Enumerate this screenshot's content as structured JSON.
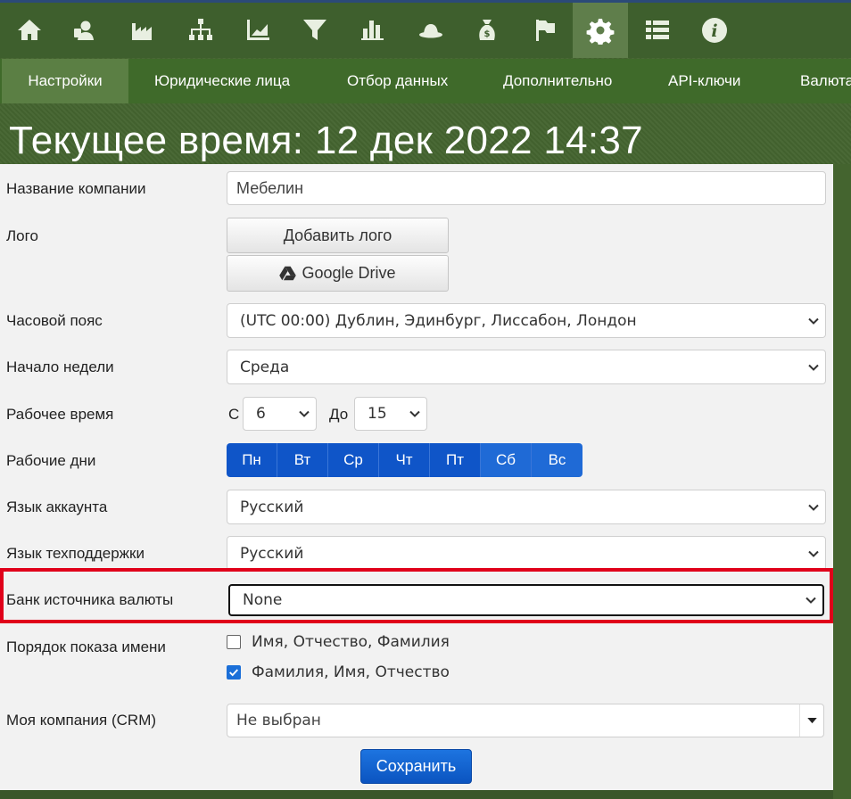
{
  "nav_icons": [
    {
      "name": "home-icon"
    },
    {
      "name": "contacts-icon"
    },
    {
      "name": "factory-icon"
    },
    {
      "name": "org-chart-icon"
    },
    {
      "name": "area-chart-icon"
    },
    {
      "name": "filter-icon"
    },
    {
      "name": "bar-chart-icon"
    },
    {
      "name": "hat-icon"
    },
    {
      "name": "money-bag-icon"
    },
    {
      "name": "flag-icon"
    },
    {
      "name": "gear-icon",
      "active": true
    },
    {
      "name": "list-icon"
    },
    {
      "name": "info-icon"
    }
  ],
  "tabs": [
    {
      "label": "Настройки",
      "active": true
    },
    {
      "label": "Юридические лица"
    },
    {
      "label": "Отбор данных"
    },
    {
      "label": "Дополнительно"
    },
    {
      "label": "API-ключи"
    },
    {
      "label": "Валюта"
    }
  ],
  "page_title": "Текущее время: 12 дек 2022 14:37",
  "form": {
    "company_name_label": "Название компании",
    "company_name_value": "Мебелин",
    "logo_label": "Лого",
    "add_logo_button": "Добавить лого",
    "google_drive_button": "Google Drive",
    "timezone_label": "Часовой пояс",
    "timezone_value": "(UTC 00:00) Дублин, Эдинбург, Лиссабон, Лондон",
    "week_start_label": "Начало недели",
    "week_start_value": "Среда",
    "work_time_label": "Рабочее время",
    "work_time_from_label": "С",
    "work_time_from_value": "6",
    "work_time_to_label": "До",
    "work_time_to_value": "15",
    "work_days_label": "Рабочие дни",
    "work_days": [
      "Пн",
      "Вт",
      "Ср",
      "Чт",
      "Пт",
      "Сб",
      "Вс"
    ],
    "account_language_label": "Язык аккаунта",
    "account_language_value": "Русский",
    "support_language_label": "Язык техподдержки",
    "support_language_value": "Русский",
    "currency_bank_label": "Банк источника валюты",
    "currency_bank_value": "None",
    "name_order_label": "Порядок показа имени",
    "name_order_option1": "Имя, Отчество, Фамилия",
    "name_order_option2": "Фамилия, Имя, Отчество",
    "name_order_selected": 2,
    "my_company_label": "Моя компания (CRM)",
    "my_company_value": "Не выбран",
    "save_button": "Сохранить"
  },
  "colors": {
    "header_green": "#3e5f2d",
    "active_icon_bg": "#5f7e4b",
    "primary_blue": "#0f55c8",
    "highlight_red": "#e0001a"
  }
}
